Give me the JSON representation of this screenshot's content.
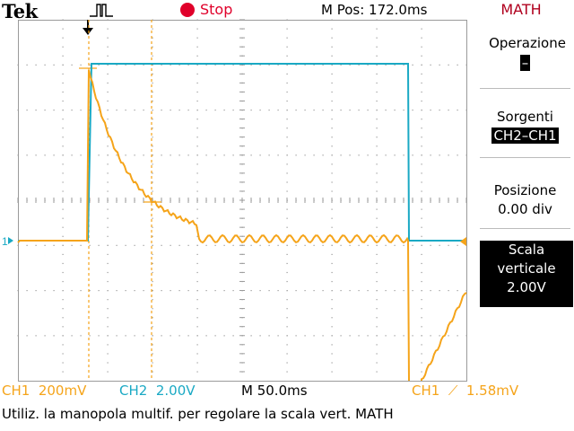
{
  "header": {
    "brand": "Tek",
    "acquire_state": "Stop",
    "horizontal_position": "M Pos: 172.0ms",
    "menu_title": "MATH"
  },
  "side_menu": {
    "operation_label": "Operazione",
    "operation_value": "–",
    "sources_label": "Sorgenti",
    "sources_value": "CH2–CH1",
    "position_label": "Posizione",
    "position_value": "0.00 div",
    "scale_label_line1": "Scala",
    "scale_label_line2": "verticale",
    "scale_value": "2.00V"
  },
  "status_bar": {
    "ch1_scale": "CH1  200mV",
    "ch2_scale": "CH2  2.00V",
    "timebase": "M 50.0ms",
    "trigger": "CH1  ⟋  1.58mV"
  },
  "hint": "Utiliz. la manopola multif. per regolare la scala vert. MATH",
  "markers": {
    "ch_ground_marker": "1"
  },
  "colors": {
    "ch1": "#f5a41a",
    "ch2": "#1aa9c4",
    "accent_red": "#e0002a",
    "grid": "#9a9a9a"
  }
}
